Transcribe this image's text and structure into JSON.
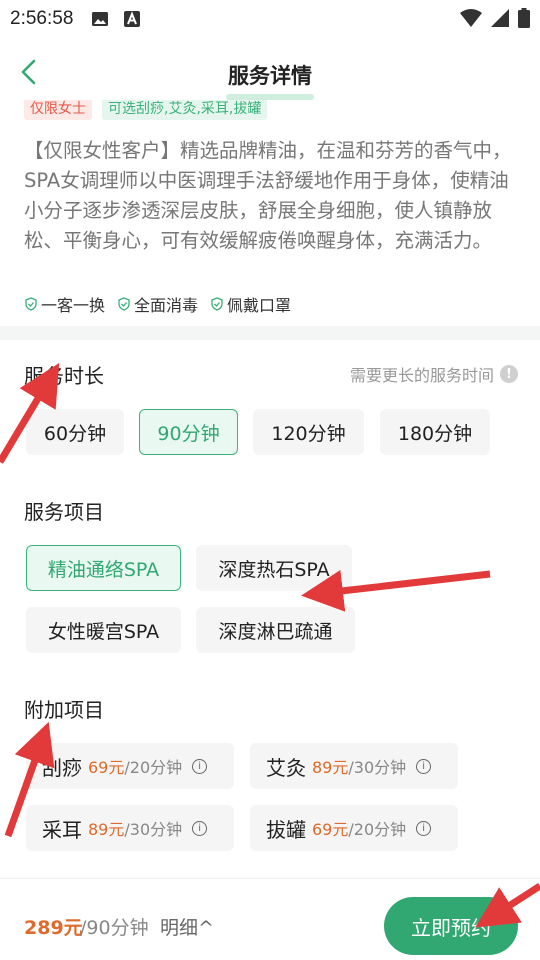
{
  "status": {
    "time": "2:56:58"
  },
  "header": {
    "title": "服务详情"
  },
  "tags": [
    "仅限女士",
    "可选刮痧,艾灸,采耳,拔罐"
  ],
  "description": "【仅限女性客户】精选品牌精油，在温和芬芳的香气中，SPA女调理师以中医调理手法舒缓地作用于身体，使精油小分子逐步渗透深层皮肤，舒展全身细胞，使人镇静放松、平衡身心，可有效缓解疲倦唤醒身体，充满活力。",
  "guarantees": [
    "一客一换",
    "全面消毒",
    "佩戴口罩"
  ],
  "duration": {
    "title": "服务时长",
    "hint": "需要更长的服务时间",
    "hint_icon": "!",
    "options": [
      "60分钟",
      "90分钟",
      "120分钟",
      "180分钟"
    ],
    "selected": "90分钟"
  },
  "services": {
    "title": "服务项目",
    "options": [
      "精油通络SPA",
      "深度热石SPA",
      "女性暖宫SPA",
      "深度淋巴疏通"
    ],
    "selected": "精油通络SPA"
  },
  "addons": {
    "title": "附加项目",
    "items": [
      {
        "name": "刮痧",
        "price": "69元",
        "duration": "/20分钟"
      },
      {
        "name": "艾灸",
        "price": "89元",
        "duration": "/30分钟"
      },
      {
        "name": "采耳",
        "price": "89元",
        "duration": "/30分钟"
      },
      {
        "name": "拔罐",
        "price": "69元",
        "duration": "/20分钟"
      }
    ]
  },
  "bottom": {
    "price": "289元",
    "unit": "/90分钟",
    "detail": "明细^",
    "book": "立即预约"
  },
  "colors": {
    "accent": "#31a872",
    "price": "#e06a2c",
    "annotation_arrow": "#e23a3a"
  },
  "icons": [
    "back-icon",
    "image-icon",
    "text-a-icon",
    "wifi-icon",
    "signal-icon",
    "battery-icon",
    "shield-check-icon",
    "info-icon"
  ]
}
